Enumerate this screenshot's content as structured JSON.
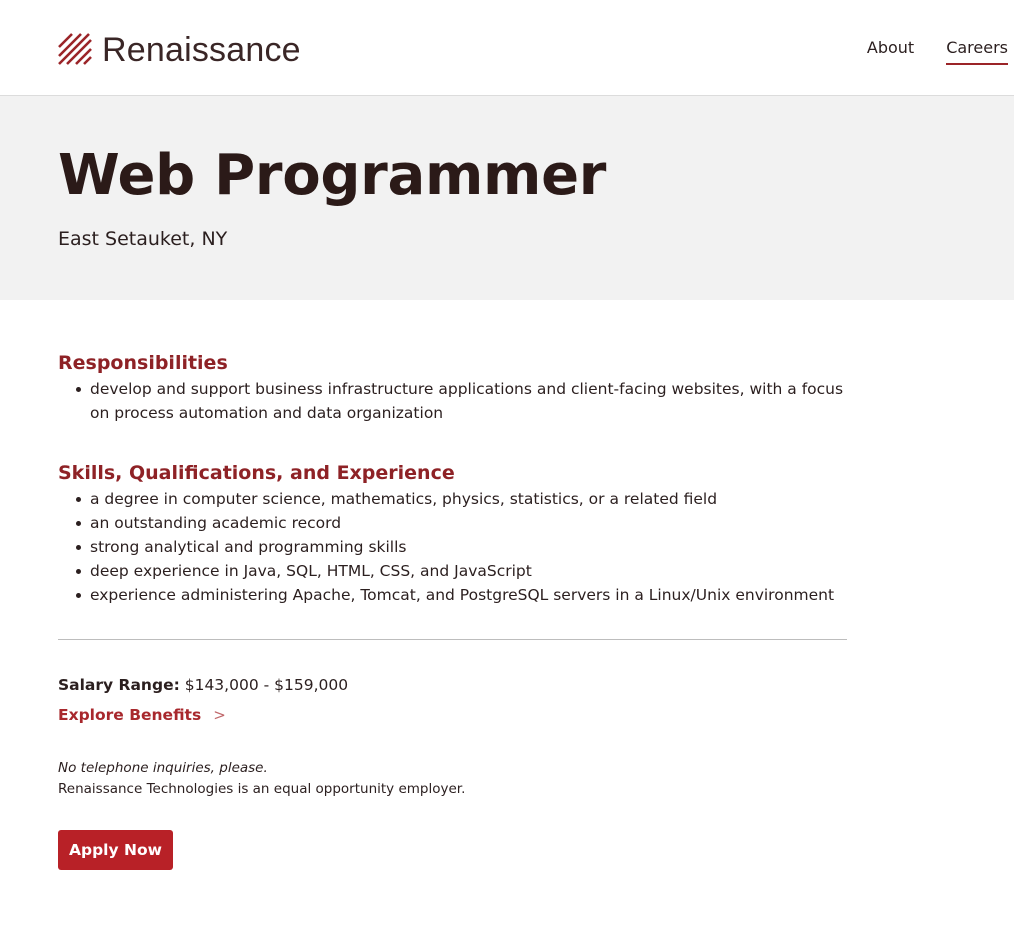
{
  "header": {
    "logo_text": "Renaissance",
    "nav": [
      {
        "label": "About"
      },
      {
        "label": "Careers",
        "active": true
      }
    ]
  },
  "hero": {
    "title": "Web Programmer",
    "location": "East Setauket, NY"
  },
  "sections": [
    {
      "heading": "Responsibilities",
      "items": [
        "develop and support business infrastructure applications and client-facing websites, with a focus on process automation and data organization"
      ]
    },
    {
      "heading": "Skills, Qualifications, and Experience",
      "items": [
        "a degree in computer science, mathematics, physics, statistics, or a related field",
        "an outstanding academic record",
        "strong analytical and programming skills",
        "deep experience in Java, SQL, HTML, CSS, and JavaScript",
        "experience administering Apache, Tomcat, and PostgreSQL servers in a Linux/Unix environment"
      ]
    }
  ],
  "salary": {
    "label": "Salary Range:",
    "value": "$143,000 - $159,000"
  },
  "benefits_link": {
    "label": "Explore Benefits",
    "chevron": ">"
  },
  "notes": {
    "phone": "No telephone inquiries, please.",
    "eeo": "Renaissance Technologies is an equal opportunity employer."
  },
  "apply_button": {
    "label": "Apply Now"
  },
  "colors": {
    "accent": "#9b2428",
    "button": "#b82127",
    "hero_bg": "#f2f2f2"
  }
}
